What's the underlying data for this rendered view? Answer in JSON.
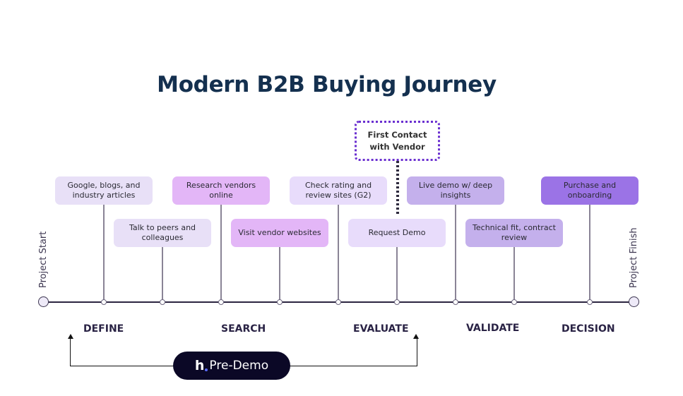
{
  "title": "Modern B2B Buying Journey",
  "timeline": {
    "start_label": "Project Start",
    "finish_label": "Project Finish"
  },
  "callout": {
    "label": "First Contact with Vendor",
    "line1": "First Contact",
    "line2": "with Vendor",
    "border_color": "#6a2fd0"
  },
  "steps": [
    {
      "label": "Google, blogs, and industry articles",
      "row": "top",
      "color": "#e8e0f7"
    },
    {
      "label": "Talk to peers and colleagues",
      "row": "bottom",
      "color": "#e8e0f7"
    },
    {
      "label": "Research vendors online",
      "row": "top",
      "color": "#e3b6f7"
    },
    {
      "label": "Visit vendor websites",
      "row": "bottom",
      "color": "#e3b6f7"
    },
    {
      "label": "Check rating and review sites (G2)",
      "row": "top",
      "color": "#e8dcfb"
    },
    {
      "label": "Request Demo",
      "row": "bottom",
      "color": "#e8dcfb"
    },
    {
      "label": "Live demo w/ deep insights",
      "row": "top",
      "color": "#c4b0ec"
    },
    {
      "label": "Technical fit, contract review",
      "row": "bottom",
      "color": "#c4b0ec"
    },
    {
      "label": "Purchase and onboarding",
      "row": "top",
      "color": "#9b73e6"
    }
  ],
  "stages": [
    "DEFINE",
    "SEARCH",
    "EVALUATE",
    "VALIDATE",
    "DECISION"
  ],
  "bracket": {
    "label": "Pre-Demo",
    "logo_glyph": "h",
    "spans": "DEFINE to EVALUATE"
  }
}
